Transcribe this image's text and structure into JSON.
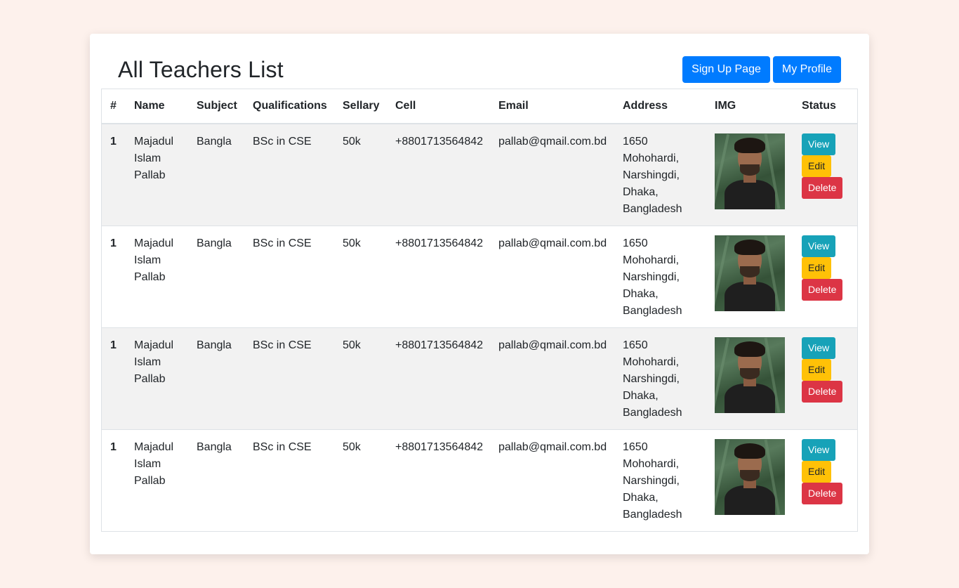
{
  "page": {
    "title": "All Teachers List"
  },
  "header_buttons": {
    "signup": "Sign Up Page",
    "profile": "My Profile"
  },
  "table": {
    "columns": [
      "#",
      "Name",
      "Subject",
      "Qualifications",
      "Sellary",
      "Cell",
      "Email",
      "Address",
      "IMG",
      "Status"
    ],
    "rows": [
      {
        "num": "1",
        "name": "Majadul Islam Pallab",
        "subject": "Bangla",
        "qualifications": "BSc in CSE",
        "sellary": "50k",
        "cell": "+8801713564842",
        "email": "pallab@qmail.com.bd",
        "address": "1650 Mohohardi, Narshingdi, Dhaka, Bangladesh"
      },
      {
        "num": "1",
        "name": "Majadul Islam Pallab",
        "subject": "Bangla",
        "qualifications": "BSc in CSE",
        "sellary": "50k",
        "cell": "+8801713564842",
        "email": "pallab@qmail.com.bd",
        "address": "1650 Mohohardi, Narshingdi, Dhaka, Bangladesh"
      },
      {
        "num": "1",
        "name": "Majadul Islam Pallab",
        "subject": "Bangla",
        "qualifications": "BSc in CSE",
        "sellary": "50k",
        "cell": "+8801713564842",
        "email": "pallab@qmail.com.bd",
        "address": "1650 Mohohardi, Narshingdi, Dhaka, Bangladesh"
      },
      {
        "num": "1",
        "name": "Majadul Islam Pallab",
        "subject": "Bangla",
        "qualifications": "BSc in CSE",
        "sellary": "50k",
        "cell": "+8801713564842",
        "email": "pallab@qmail.com.bd",
        "address": "1650 Mohohardi, Narshingdi, Dhaka, Bangladesh"
      }
    ]
  },
  "actions": {
    "view": "View",
    "edit": "Edit",
    "delete": "Delete"
  },
  "colors": {
    "background": "#fdf1ec",
    "primary": "#007bff",
    "info": "#17a2b8",
    "warning": "#ffc107",
    "danger": "#dc3545",
    "stripe": "#f2f2f2"
  }
}
